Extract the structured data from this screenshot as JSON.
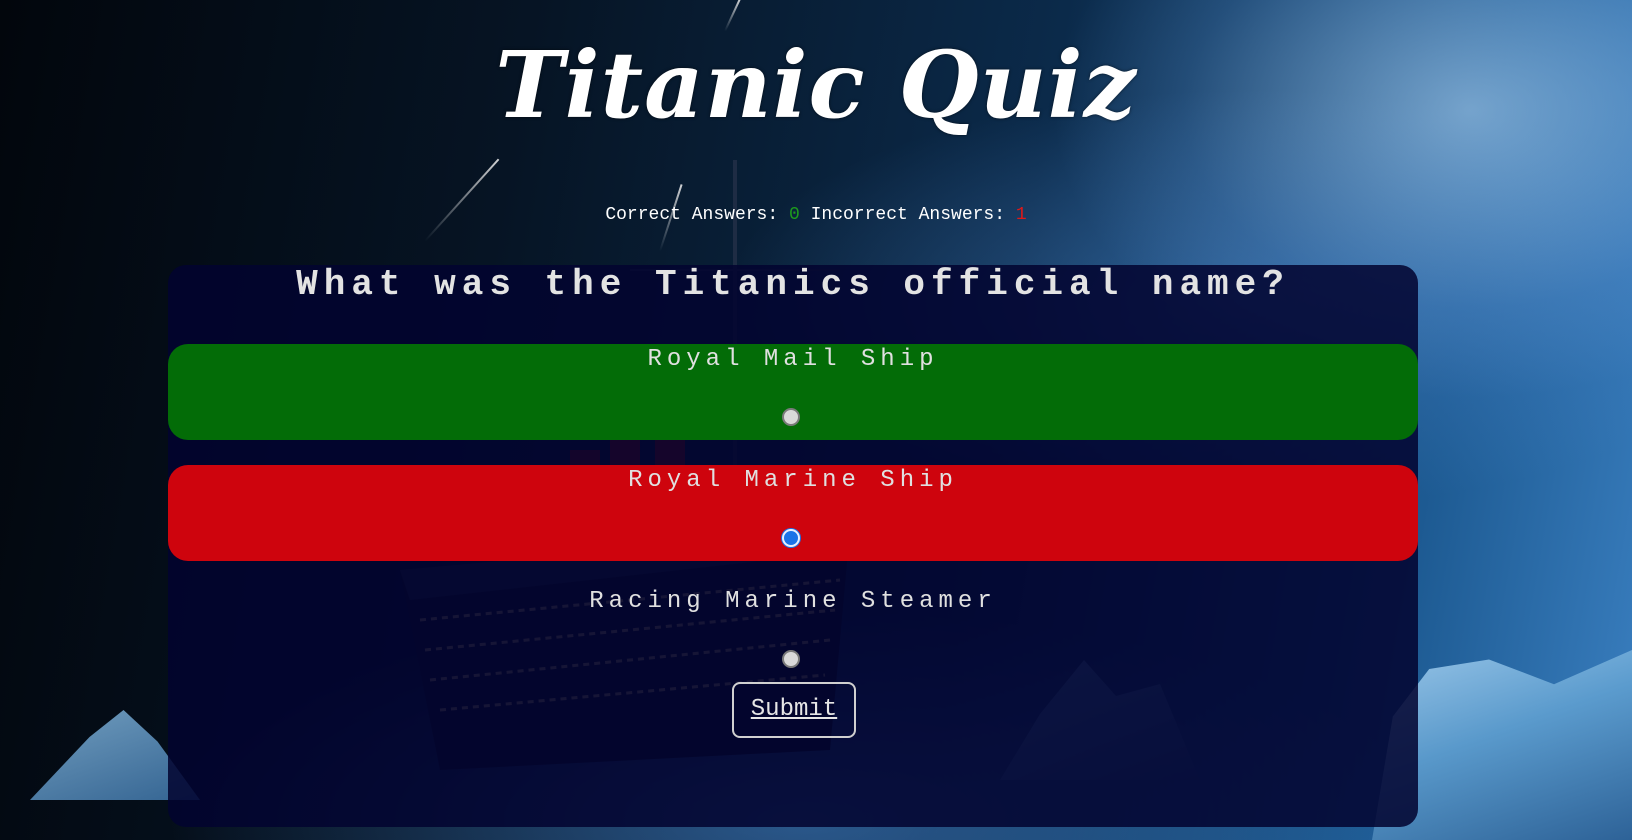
{
  "page": {
    "title": "Titanic Quiz"
  },
  "score": {
    "correct_label": "Correct Answers:",
    "correct_value": "0",
    "incorrect_label": "Incorrect Answers:",
    "incorrect_value": "1"
  },
  "quiz": {
    "question": "What was the Titanics official name?",
    "options": [
      {
        "label": "Royal Mail Ship",
        "state": "correct",
        "selected": false
      },
      {
        "label": "Royal Marine Ship",
        "state": "incorrect",
        "selected": true
      },
      {
        "label": "Racing Marine Steamer",
        "state": "neutral",
        "selected": false
      }
    ],
    "submit_label": "Submit"
  },
  "colors": {
    "correct_bg": "#036e06",
    "incorrect_bg": "#d2040c",
    "panel_bg": "#020430",
    "correct_count": "#1d9b1d",
    "incorrect_count": "#e01818",
    "radio_checked": "#1a73e8"
  }
}
